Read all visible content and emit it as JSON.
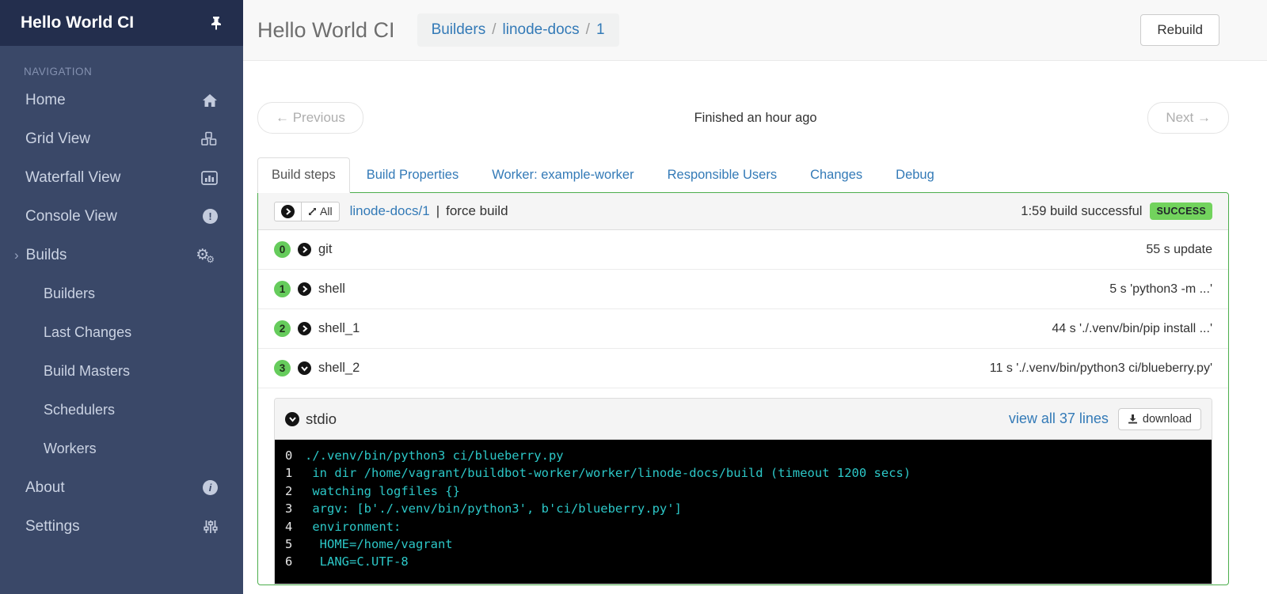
{
  "sidebar": {
    "title": "Hello World CI",
    "section_label": "NAVIGATION",
    "items": [
      {
        "label": "Home",
        "icon": "home-icon"
      },
      {
        "label": "Grid View",
        "icon": "cubes-icon"
      },
      {
        "label": "Waterfall View",
        "icon": "bar-chart-icon"
      },
      {
        "label": "Console View",
        "icon": "exclamation-circle-icon"
      },
      {
        "label": "Builds",
        "icon": "gears-icon",
        "expanded": true
      },
      {
        "label": "About",
        "icon": "info-circle-icon"
      },
      {
        "label": "Settings",
        "icon": "sliders-icon"
      }
    ],
    "builds_children": [
      {
        "label": "Builders"
      },
      {
        "label": "Last Changes"
      },
      {
        "label": "Build Masters"
      },
      {
        "label": "Schedulers"
      },
      {
        "label": "Workers"
      }
    ]
  },
  "header": {
    "title": "Hello World CI",
    "breadcrumb": {
      "0": "Builders",
      "1": "linode-docs",
      "2": "1",
      "separator": "/"
    },
    "rebuild_label": "Rebuild"
  },
  "pager": {
    "previous_label": "← Previous",
    "status_text": "Finished an hour ago",
    "next_label": "Next →"
  },
  "tabs": {
    "0": {
      "label": "Build steps",
      "active": true
    },
    "1": {
      "label": "Build Properties"
    },
    "2": {
      "label": "Worker: example-worker"
    },
    "3": {
      "label": "Responsible Users"
    },
    "4": {
      "label": "Changes"
    },
    "5": {
      "label": "Debug"
    }
  },
  "summary": {
    "expand_all_label": "All",
    "builder_link": "linode-docs/1",
    "separator": "|",
    "reason": "force build",
    "duration_status": "1:59 build successful",
    "badge": "SUCCESS"
  },
  "steps": {
    "0": {
      "number": "0",
      "name": "git",
      "detail": "55 s update"
    },
    "1": {
      "number": "1",
      "name": "shell",
      "detail": "5 s 'python3 -m ...'"
    },
    "2": {
      "number": "2",
      "name": "shell_1",
      "detail": "44 s './.venv/bin/pip install ...'"
    },
    "3": {
      "number": "3",
      "name": "shell_2",
      "detail": "11 s './.venv/bin/python3 ci/blueberry.py'"
    }
  },
  "stdio": {
    "title": "stdio",
    "view_all_label": "view all 37 lines",
    "download_label": "download",
    "lines": {
      "0": {
        "num": "0",
        "text": "./.venv/bin/python3 ci/blueberry.py"
      },
      "1": {
        "num": "1",
        "text": " in dir /home/vagrant/buildbot-worker/worker/linode-docs/build (timeout 1200 secs)"
      },
      "2": {
        "num": "2",
        "text": " watching logfiles {}"
      },
      "3": {
        "num": "3",
        "text": " argv: [b'./.venv/bin/python3', b'ci/blueberry.py']"
      },
      "4": {
        "num": "4",
        "text": " environment:"
      },
      "5": {
        "num": "5",
        "text": "  HOME=/home/vagrant"
      },
      "6": {
        "num": "6",
        "text": "  LANG=C.UTF-8"
      }
    }
  },
  "colors": {
    "sidebar_bg": "#3a4868",
    "sidebar_header_bg": "#232e4d",
    "link_blue": "#337ab7",
    "success_green": "#72d35d",
    "panel_border_green": "#4cae4c",
    "terminal_text_cyan": "#2cc7c7"
  }
}
